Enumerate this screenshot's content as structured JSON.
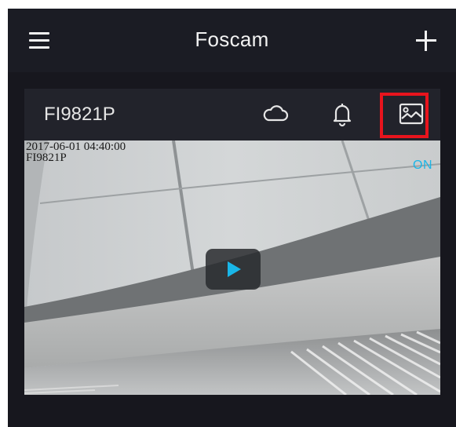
{
  "app_bar": {
    "title": "Foscam",
    "menu_icon": "hamburger-menu-icon",
    "add_icon": "plus-icon"
  },
  "camera_card": {
    "name": "FI9821P",
    "icons": [
      "cloud-icon",
      "bell-icon",
      "gallery-icon"
    ],
    "highlighted_icon": "gallery-icon",
    "video": {
      "osd_timestamp": "2017-06-01 04:40:00",
      "osd_name": "FI9821P",
      "status": "ON",
      "play_icon": "play-icon"
    }
  },
  "colors": {
    "background": "#17171e",
    "card": "#22232b",
    "accent": "#19b6e8",
    "highlight": "#e8141d",
    "text": "#f2f2f2"
  }
}
